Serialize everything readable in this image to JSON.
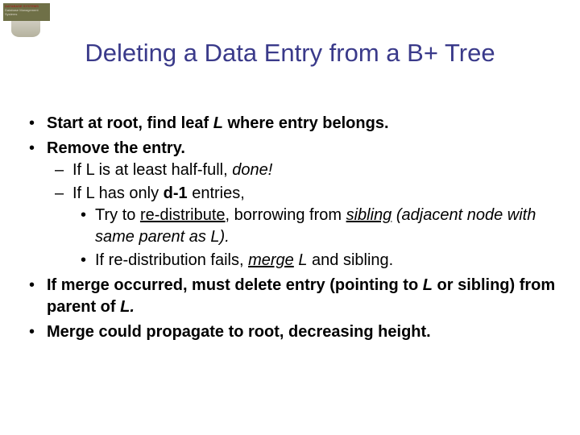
{
  "logo": {
    "line1": "DATABASE SYSTEMS",
    "line2": "Database Management",
    "line3": "Systems"
  },
  "title": "Deleting a Data Entry from a B+ Tree",
  "b1_pre": "Start at root, find leaf ",
  "b1_L": "L",
  "b1_post": " where entry belongs.",
  "b2": "Remove the entry.",
  "b2a_pre": "If L is at least half-full, ",
  "b2a_done": "done!",
  "b2b_pre": "If L has only ",
  "b2b_d1": "d-1",
  "b2b_post": " entries,",
  "b2b_i_pre": "Try to ",
  "b2b_i_redist": "re-distribute",
  "b2b_i_mid": ", borrowing from ",
  "b2b_i_sibling": "sibling",
  "b2b_i_paren": " (adjacent node with same parent as L).",
  "b2b_ii_pre": "If re-distribution fails, ",
  "b2b_ii_merge": "merge",
  "b2b_ii_post1": " L",
  "b2b_ii_post2": " and sibling.",
  "b3_pre": "If merge occurred, must delete entry (pointing to ",
  "b3_L1": "L",
  "b3_mid": " or sibling) from parent of ",
  "b3_L2": "L.",
  "b4": "Merge could propagate to root, decreasing height."
}
